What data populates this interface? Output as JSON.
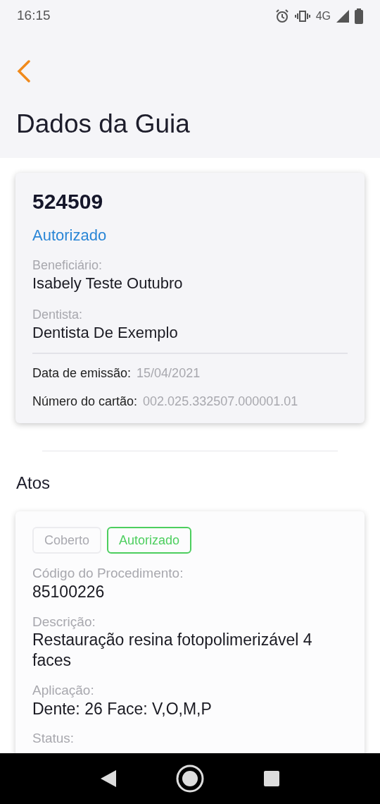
{
  "status_bar": {
    "time": "16:15",
    "network": "4G"
  },
  "header": {
    "title": "Dados da Guia"
  },
  "guide": {
    "number": "524509",
    "status": "Autorizado",
    "fields": [
      {
        "label": "Beneficiário:",
        "value": "Isabely Teste Outubro"
      },
      {
        "label": "Dentista:",
        "value": "Dentista De Exemplo"
      }
    ],
    "details": [
      {
        "label": "Data de emissão:",
        "value": "15/04/2021"
      },
      {
        "label": "Número do cartão:",
        "value": "002.025.332507.000001.01"
      }
    ]
  },
  "section_title": "Atos",
  "acts": [
    {
      "badges": [
        {
          "label": "Coberto",
          "active": false
        },
        {
          "label": "Autorizado",
          "active": true
        }
      ],
      "fields": [
        {
          "label": "Código do Procedimento:",
          "value": "85100226"
        },
        {
          "label": "Descrição:",
          "value": "Restauração resina fotopolimerizável 4 faces"
        },
        {
          "label": "Aplicação:",
          "value": "Dente: 26 Face: V,O,M,P"
        },
        {
          "label": "Status:"
        }
      ]
    }
  ]
}
